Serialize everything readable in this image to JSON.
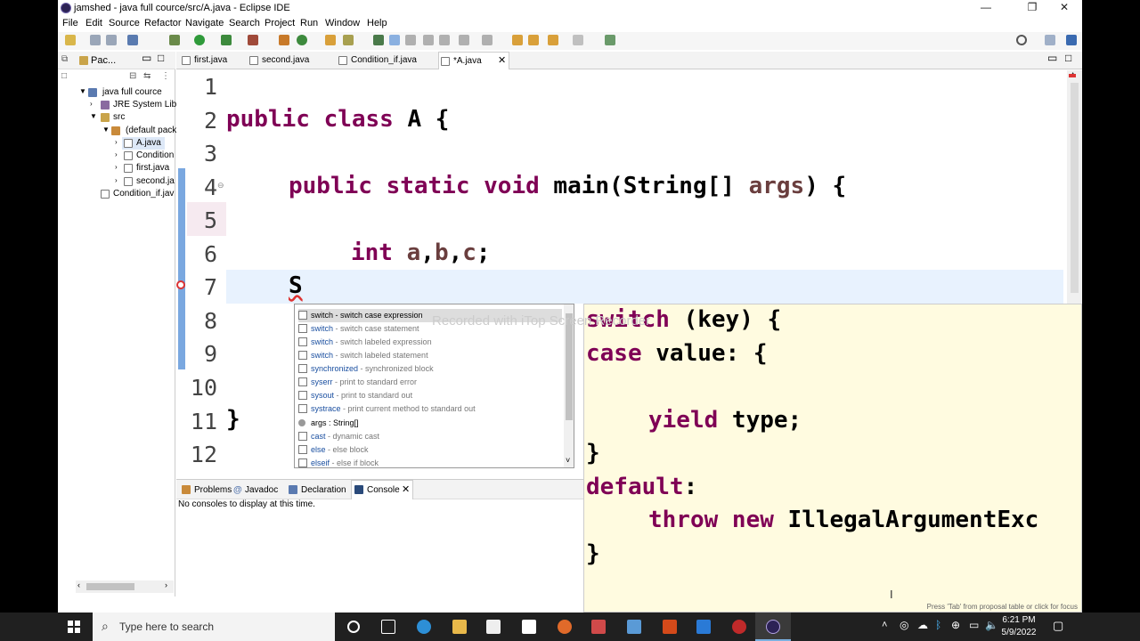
{
  "window": {
    "title": "jamshed - java full cource/src/A.java - Eclipse IDE",
    "minimize": "—",
    "maximize": "❐",
    "close": "✕"
  },
  "menu": [
    "File",
    "Edit",
    "Source",
    "Refactor",
    "Navigate",
    "Search",
    "Project",
    "Run",
    "Window",
    "Help"
  ],
  "explorer": {
    "title": "Pac...",
    "tree": [
      "java full cource",
      "JRE System Libra",
      "src",
      "(default pack",
      "A.java",
      "Condition",
      "first.java",
      "second.ja",
      "Condition_if.jav"
    ]
  },
  "editor_tabs": [
    "first.java",
    "second.java",
    "Condition_if.java",
    "*A.java"
  ],
  "line_numbers": [
    "1",
    "2",
    "3",
    "4",
    "5",
    "6",
    "7",
    "8",
    "9",
    "10",
    "11",
    "12"
  ],
  "code": {
    "l2_kw": "public class ",
    "l2_rest": "A {",
    "l4_kw": "public static void ",
    "l4_mid": "main(String[] ",
    "l4_var": "args",
    "l4_end": ") {",
    "l6_kw": "int ",
    "l6_a": "a",
    "l6_b": "b",
    "l6_c": "c",
    "l6_comma": ",",
    "l6_semi": ";",
    "l7": "S",
    "l11": "}"
  },
  "proposals": [
    {
      "kw": "switch",
      "desc": " - switch case expression",
      "selected": true
    },
    {
      "kw": "switch",
      "desc": " - switch case statement"
    },
    {
      "kw": "switch",
      "desc": " - switch labeled expression"
    },
    {
      "kw": "switch",
      "desc": " - switch labeled statement"
    },
    {
      "kw": "synchronized",
      "desc": " - synchronized block"
    },
    {
      "kw": "syserr",
      "desc": " - print to standard error"
    },
    {
      "kw": "sysout",
      "desc": " - print to standard out"
    },
    {
      "kw": "systrace",
      "desc": " - print current method to standard out"
    },
    {
      "kw": "args : String[]",
      "desc": ""
    },
    {
      "kw": "cast",
      "desc": " - dynamic cast"
    },
    {
      "kw": "else",
      "desc": " - else block"
    },
    {
      "kw": "elseif",
      "desc": " - else if block"
    }
  ],
  "preview": {
    "l1_kw": "switch",
    "l1_rest": " (key) {",
    "l2_kw": "case",
    "l2_rest": " value: {",
    "l4_kw": "yield",
    "l4_rest": " type;",
    "l5": "}",
    "l6_kw": "default",
    "l6_rest": ":",
    "l7_kw": "throw new",
    "l7_rest": " IllegalArgumentExc",
    "l8": "}",
    "hint": "Press 'Tab' from proposal table or click for focus"
  },
  "watermark": "Recorded with iTop Screen Recorder",
  "bottom_panel": {
    "tabs": [
      "Problems",
      "Javadoc",
      "Declaration",
      "Console"
    ],
    "message": "No consoles to display at this time."
  },
  "taskbar": {
    "search_placeholder": "Type here to search",
    "time": "6:21 PM",
    "date": "5/9/2022"
  },
  "colors": {
    "keyword": "#7f0055",
    "variable": "#6a3e3e",
    "preview_bg": "#fffbe0",
    "current_line": "#e8f2fe"
  }
}
